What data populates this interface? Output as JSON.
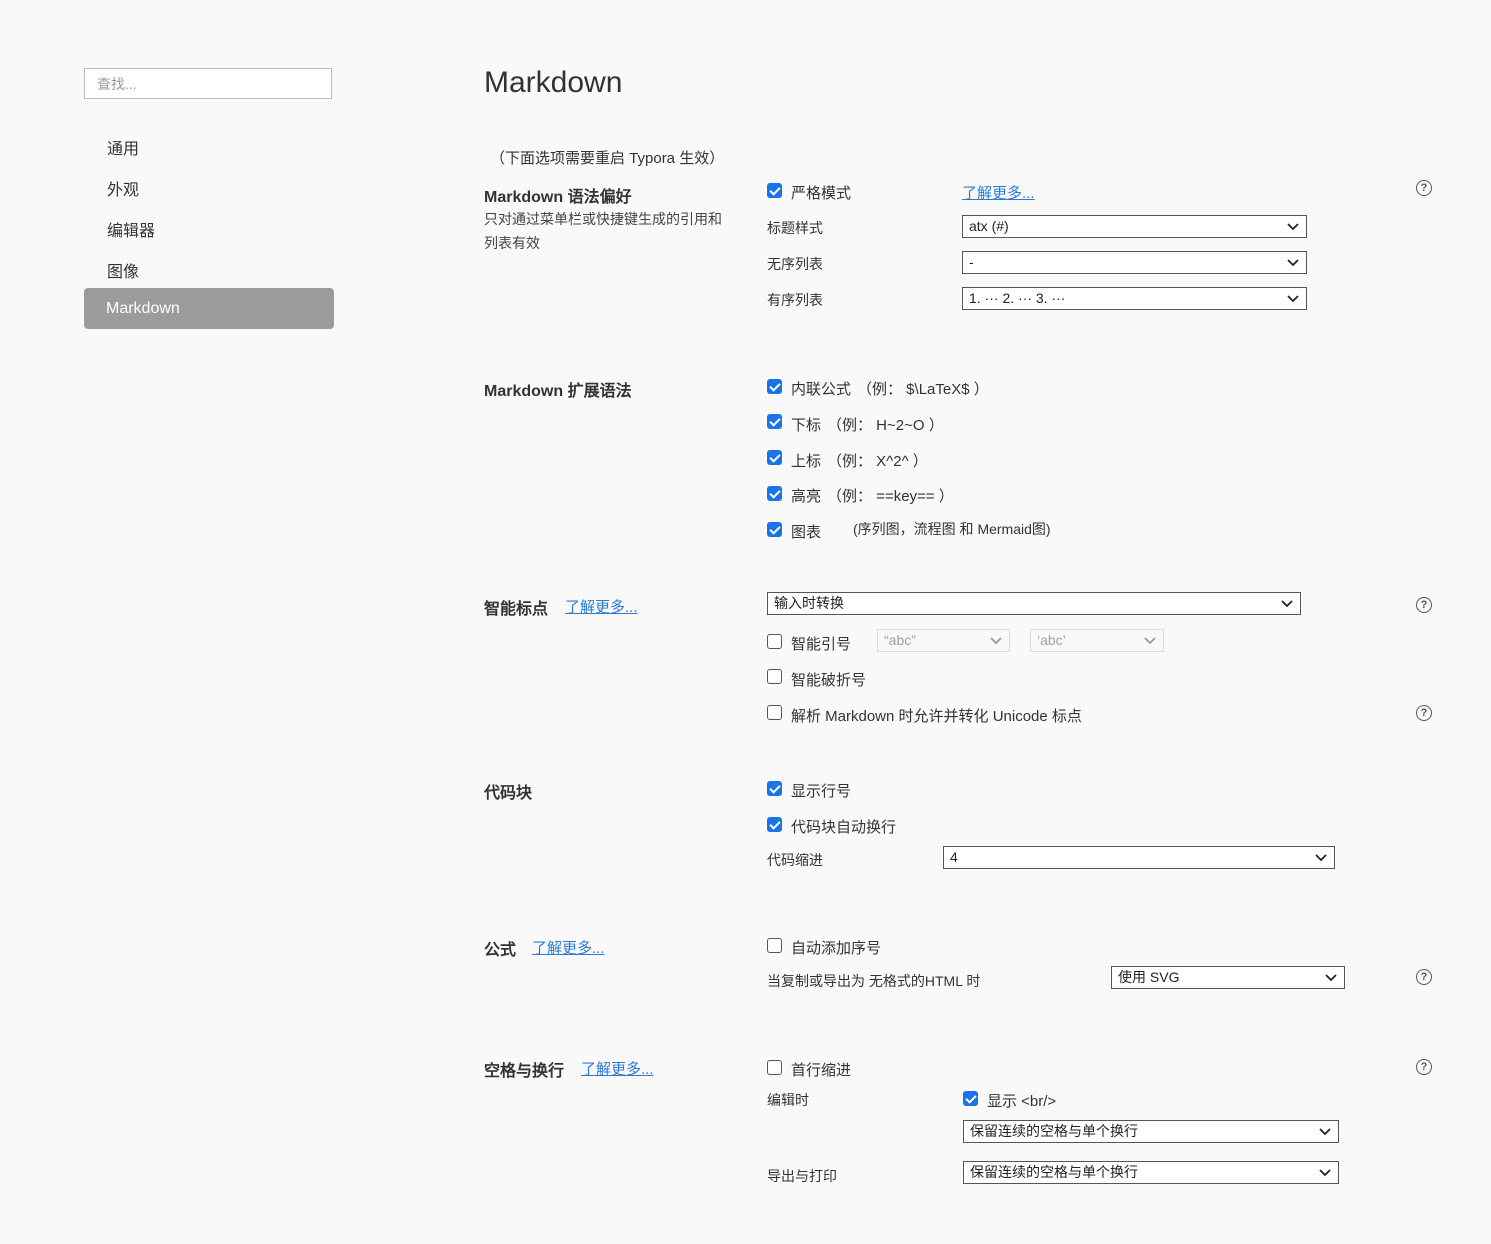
{
  "sidebar": {
    "search_placeholder": "查找...",
    "items": [
      {
        "label": "通用"
      },
      {
        "label": "外观"
      },
      {
        "label": "编辑器"
      },
      {
        "label": "图像"
      },
      {
        "label": "Markdown",
        "active": true
      }
    ]
  },
  "main": {
    "title": "Markdown",
    "restart_note": "（下面选项需要重启 Typora 生效）",
    "syntax_pref": {
      "title": "Markdown 语法偏好",
      "desc": "只对通过菜单栏或快捷键生成的引用和列表有效",
      "strict_mode": {
        "label": "严格模式",
        "checked": true
      },
      "learn_more": "了解更多...",
      "heading_style": {
        "label": "标题样式",
        "value": "atx (#)"
      },
      "unordered_list": {
        "label": "无序列表",
        "value": "-"
      },
      "ordered_list": {
        "label": "有序列表",
        "value": "1. ··· 2. ··· 3. ···"
      }
    },
    "extended_syntax": {
      "title": "Markdown 扩展语法",
      "options": [
        {
          "label": "内联公式",
          "example": "（例： $\\LaTeX$ ）",
          "checked": true
        },
        {
          "label": "下标",
          "example": "（例： H~2~O ）",
          "checked": true
        },
        {
          "label": "上标",
          "example": "（例： X^2^ ）",
          "checked": true
        },
        {
          "label": "高亮",
          "example": "（例： ==key== ）",
          "checked": true
        },
        {
          "label": "图表",
          "example": "(序列图，流程图 和 Mermaid图)",
          "checked": true
        }
      ]
    },
    "smart_punct": {
      "title": "智能标点",
      "learn_more": "了解更多...",
      "mode": "输入时转换",
      "smart_quotes": {
        "label": "智能引号",
        "checked": false,
        "double_value": "“abc”",
        "single_value": "‘abc’"
      },
      "smart_dash": {
        "label": "智能破折号",
        "checked": false
      },
      "unicode_punct": {
        "label": "解析 Markdown 时允许并转化 Unicode 标点",
        "checked": false
      }
    },
    "code_block": {
      "title": "代码块",
      "line_numbers": {
        "label": "显示行号",
        "checked": true
      },
      "auto_wrap": {
        "label": "代码块自动换行",
        "checked": true
      },
      "indent": {
        "label": "代码缩进",
        "value": "4"
      }
    },
    "math": {
      "title": "公式",
      "learn_more": "了解更多...",
      "auto_number": {
        "label": "自动添加序号",
        "checked": false
      },
      "export": {
        "label": "当复制或导出为 无格式的HTML 时",
        "value": "使用 SVG"
      }
    },
    "whitespace": {
      "title": "空格与换行",
      "learn_more": "了解更多...",
      "first_line_indent": {
        "label": "首行缩进",
        "checked": false
      },
      "editing_label": "编辑时",
      "show_br": {
        "label": "显示 <br/>",
        "checked": true
      },
      "editing_value": "保留连续的空格与单个换行",
      "export_label": "导出与打印",
      "export_value": "保留连续的空格与单个换行"
    }
  },
  "colors": {
    "accent": "#1a73e8",
    "link": "#2a7ad3",
    "active_nav_bg": "#9b9b9b",
    "background": "#f9f9f9"
  },
  "icons": {
    "help": "question-circle-icon",
    "dropdown": "chevron-down-icon",
    "check": "checkmark-icon"
  }
}
